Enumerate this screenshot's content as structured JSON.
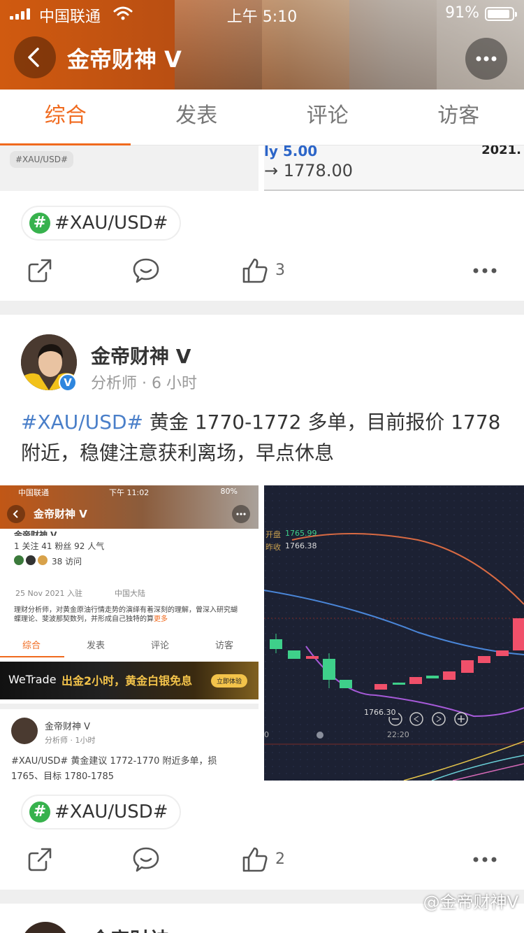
{
  "status_bar": {
    "carrier": "中国联通",
    "time": "上午 5:10",
    "battery": "91%",
    "battery_level": 0.91
  },
  "header": {
    "title": "金帝财神 V"
  },
  "tabs": [
    {
      "label": "综合",
      "active": true
    },
    {
      "label": "发表"
    },
    {
      "label": "评论"
    },
    {
      "label": "访客"
    }
  ],
  "prev_post": {
    "image_left_tag": "#XAU/USD#",
    "image_right_line1": "ly 5.00",
    "image_right_line2": "→ 1778.00",
    "image_right_corner": "2021.",
    "hashtag": "#XAU/USD#",
    "like_count": "3"
  },
  "post": {
    "author": "金帝财神 V",
    "meta": "分析师 · 6 小时",
    "verified_badge": "V",
    "text_tag": "#XAU/USD#",
    "text_body": " 黄金 1770-1772 多单，目前报价 1778 附近，稳健注意获利离场，早点休息",
    "hashtag": "#XAU/USD#",
    "like_count": "2",
    "embedded_screenshot": {
      "carrier": "中国联通",
      "time": "下午 11:02",
      "battery": "80%",
      "title": "金帝财神 V",
      "name_line": "金帝财神 V",
      "stats": "1 关注  41 粉丝  92 人气",
      "visits": "38 访问",
      "joined": "25 Nov 2021 入驻",
      "location": "中国大陆",
      "bio": "理财分析师，对黄金原油行情走势的演绎有着深刻的理解，曾深入研究蝴蝶理论、斐波那契数列，并形成自己独特的算",
      "bio_more": "更多",
      "tabs": [
        "综合",
        "发表",
        "评论",
        "访客"
      ],
      "banner_brand": "WeTrade",
      "banner_text": "出金2小时，黄金白银免息",
      "banner_button": "立即体验",
      "post_author": "金帝财神 V",
      "post_meta": "分析师 · 1小时",
      "post_text": "#XAU/USD# 黄金建议 1772-1770 附近多单，损 1765、目标 1780-1785"
    },
    "chart": {
      "open_label": "开盘",
      "open_value": "1765.99",
      "prev_close_label": "昨收",
      "prev_close_value": "1766.38",
      "price_tag": "1766.30",
      "time_label": "22:20",
      "left_tick": "0"
    }
  },
  "next_post": {
    "author_partial": "金帝财神"
  },
  "watermark": "@金帝财神V",
  "colors": {
    "accent": "#f06a1e",
    "hashtag_green": "#37b24d",
    "link_blue": "#4a7fc9",
    "verified_blue": "#2e86de"
  }
}
